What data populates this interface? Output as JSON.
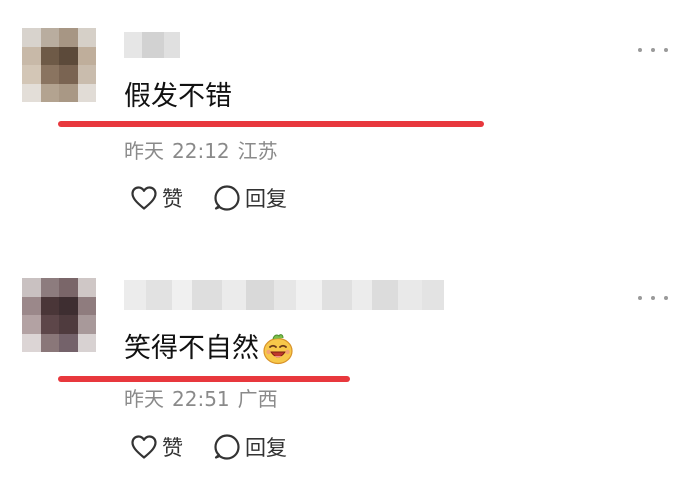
{
  "comments": [
    {
      "text": "假发不错",
      "time_label": "昨天",
      "time_value": "22:12",
      "location": "江苏",
      "like_label": "赞",
      "reply_label": "回复",
      "icons": [
        "heart-icon",
        "chat-bubble-icon",
        "more-dots-icon"
      ]
    },
    {
      "text": "笑得不自然",
      "time_label": "昨天",
      "time_value": "22:51",
      "location": "广西",
      "like_label": "赞",
      "reply_label": "回复",
      "emoji": "laughing-face-icon",
      "icons": [
        "heart-icon",
        "chat-bubble-icon",
        "more-dots-icon"
      ]
    }
  ],
  "colors": {
    "highlight_underline": "#e8383d",
    "meta_text": "#8a8a8a",
    "content_text": "#111111",
    "action_text": "#333333"
  }
}
